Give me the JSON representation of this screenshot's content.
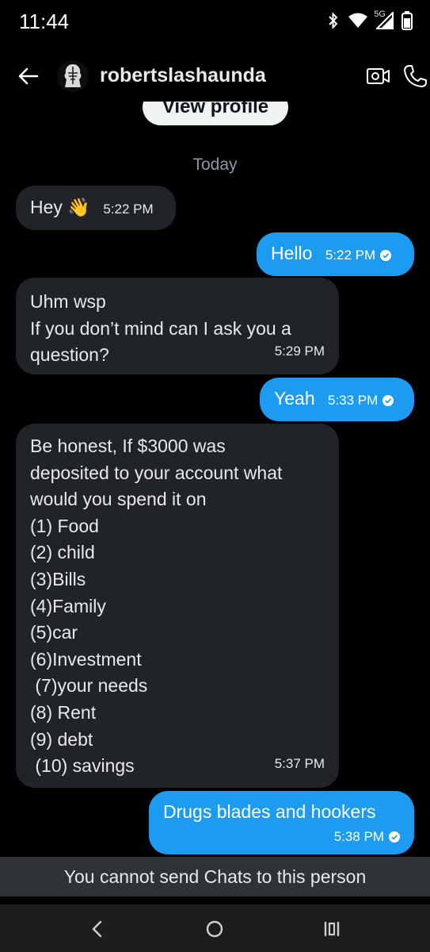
{
  "status_bar": {
    "time": "11:44",
    "network": "5G",
    "icons": [
      "bluetooth-icon",
      "wifi-icon",
      "signal-icon",
      "battery-icon"
    ]
  },
  "header": {
    "name": "robertslashaunda",
    "icons": [
      "back-arrow-icon",
      "avatar",
      "video-call-icon",
      "phone-call-icon"
    ]
  },
  "view_profile_label": "View profile",
  "date_separator": "Today",
  "messages": [
    {
      "dir": "in",
      "lines": [
        "Hey 👋"
      ],
      "time": "5:22 PM"
    },
    {
      "dir": "out",
      "lines": [
        "Hello"
      ],
      "time": "5:22 PM",
      "read": true
    },
    {
      "dir": "in",
      "lines": [
        "Uhm wsp",
        "If you don’t mind can I ask you a",
        "question?"
      ],
      "time": "5:29 PM"
    },
    {
      "dir": "out",
      "lines": [
        "Yeah"
      ],
      "time": "5:33 PM",
      "read": true
    },
    {
      "dir": "in",
      "lines": [
        "Be honest, If $3000 was",
        "deposited to your account what",
        "would you spend it on",
        "(1) Food",
        "(2) child",
        "(3)Bills",
        "(4)Family",
        "(5)car",
        "(6)Investment",
        " (7)your needs",
        "(8) Rent",
        "(9) debt",
        " (10) savings"
      ],
      "time": "5:37 PM"
    },
    {
      "dir": "out",
      "lines": [
        "Drugs blades and hookers"
      ],
      "time": "5:38 PM",
      "read": true
    }
  ],
  "notice": "You cannot send Chats to this person",
  "nav": [
    "back-nav-icon",
    "home-nav-icon",
    "recents-nav-icon"
  ],
  "colors": {
    "background": "#000000",
    "incoming_bubble": "#202327",
    "outgoing_bubble": "#1d9bf0",
    "notice_bar": "#2f3336"
  }
}
